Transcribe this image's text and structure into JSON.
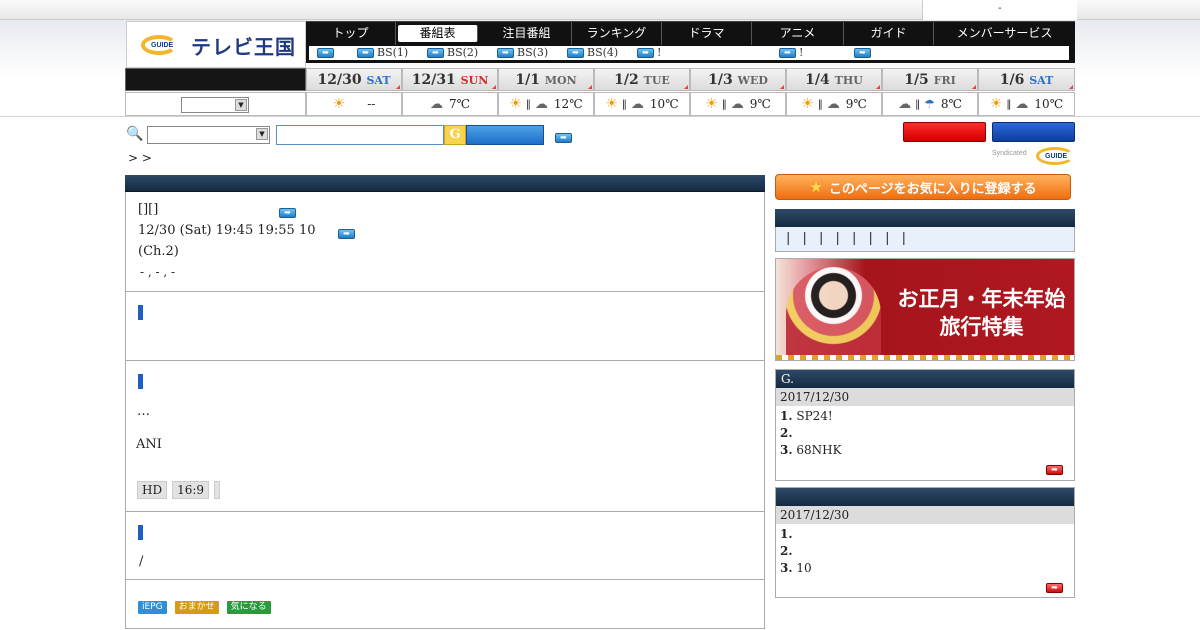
{
  "topbar": {
    "right_text": "-"
  },
  "logo": {
    "mark": "GUIDE",
    "text": "テレビ王国"
  },
  "nav": {
    "items": [
      "トップ",
      "番組表",
      "注目番組",
      "ランキング",
      "ドラマ",
      "アニメ",
      "ガイド",
      "メンバーサービス"
    ],
    "active": "番組表"
  },
  "subnav": {
    "items": [
      "",
      "BS(1)",
      "BS(2)",
      "BS(3)",
      "BS(4)",
      "!",
      "!",
      ""
    ]
  },
  "dates": [
    {
      "date": "12/30",
      "dow": "SAT",
      "type": "sat"
    },
    {
      "date": "12/31",
      "dow": "SUN",
      "type": "sun"
    },
    {
      "date": "1/1",
      "dow": "MON",
      "type": ""
    },
    {
      "date": "1/2",
      "dow": "TUE",
      "type": ""
    },
    {
      "date": "1/3",
      "dow": "WED",
      "type": ""
    },
    {
      "date": "1/4",
      "dow": "THU",
      "type": ""
    },
    {
      "date": "1/5",
      "dow": "FRI",
      "type": ""
    },
    {
      "date": "1/6",
      "dow": "SAT",
      "type": "sat"
    }
  ],
  "weather": [
    {
      "icons": "sun",
      "temp": "--"
    },
    {
      "icons": "cloud",
      "temp": "7℃"
    },
    {
      "icons": "sun|cloud",
      "temp": "12℃"
    },
    {
      "icons": "sun|cloud",
      "temp": "10℃"
    },
    {
      "icons": "sun|cloud",
      "temp": "9℃"
    },
    {
      "icons": "sun|cloud",
      "temp": "9℃"
    },
    {
      "icons": "cloud|rain",
      "temp": "8℃"
    },
    {
      "icons": "sun|cloud",
      "temp": "10℃"
    }
  ],
  "search": {
    "placeholder": "",
    "g_mark": "G"
  },
  "breadcrumb": "> >",
  "syndicated": {
    "label": "Syndicated",
    "mark": "GUIDE"
  },
  "program": {
    "title": "[][]",
    "datetime": "12/30 (Sat) 19:45  19:55 10",
    "channel": "(Ch.2)",
    "cast": "-     ,  -     ,  -",
    "detail_line1": "…",
    "detail_line2": "ANI",
    "tags": [
      "HD",
      "16:9",
      ""
    ],
    "section4_text": "/",
    "buttons": [
      {
        "label": "iEPG",
        "color": "#2d8fd6"
      },
      {
        "label": "おまかせ",
        "color": "#d49b14"
      },
      {
        "label": "気になる",
        "color": "#2c9a3c"
      }
    ]
  },
  "right": {
    "fav_label": "このページをお気に入りに登録する",
    "links_row": "| | | | | | | |",
    "banner": {
      "line1": "お正月・年末年始",
      "line2": "旅行特集"
    },
    "ranking1": {
      "title": "G.",
      "date": "2017/12/30",
      "items": [
        {
          "rank": "1.",
          "text": "SP24!"
        },
        {
          "rank": "2.",
          "text": ""
        },
        {
          "rank": "3.",
          "text": "68NHK"
        }
      ]
    },
    "ranking2": {
      "title": "",
      "date": "2017/12/30",
      "items": [
        {
          "rank": "1.",
          "text": ""
        },
        {
          "rank": "2.",
          "text": ""
        },
        {
          "rank": "3.",
          "text": "10"
        }
      ]
    }
  }
}
